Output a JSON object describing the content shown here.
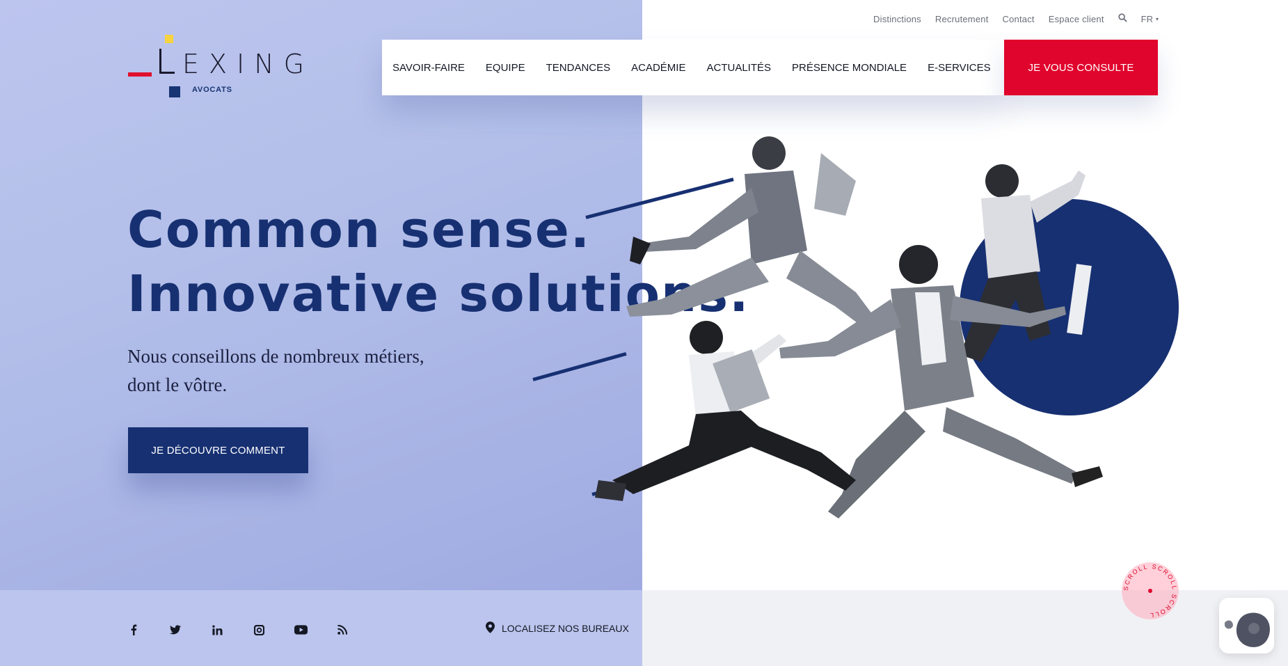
{
  "utility_nav": {
    "links": [
      "Distinctions",
      "Recrutement",
      "Contact",
      "Espace client"
    ],
    "language": "FR"
  },
  "logo": {
    "wordmark": "EXING",
    "subtitle": "AVOCATS"
  },
  "main_nav": {
    "items": [
      "SAVOIR-FAIRE",
      "EQUIPE",
      "TENDANCES",
      "ACADÉMIE",
      "ACTUALITÉS",
      "PRÉSENCE MONDIALE",
      "E-SERVICES"
    ],
    "cta": "JE VOUS CONSULTE"
  },
  "hero": {
    "title_line1": "Common sense.",
    "title_line2": "Innovative solutions.",
    "subtitle_line1": "Nous conseillons de nombreux métiers,",
    "subtitle_line2": "dont le vôtre.",
    "cta": "JE DÉCOUVRE COMMENT"
  },
  "footer": {
    "social_icons": [
      "facebook-icon",
      "twitter-icon",
      "linkedin-icon",
      "instagram-icon",
      "youtube-icon",
      "rss-icon"
    ],
    "locate_label": "LOCALISEZ NOS BUREAUX"
  },
  "scroll_badge": {
    "text": "SCROLL SCROLL SCROLL"
  },
  "colors": {
    "navy": "#173072",
    "red": "#e0052c",
    "yellow": "#f6d33f",
    "periwinkle": "#b3bfe9"
  }
}
